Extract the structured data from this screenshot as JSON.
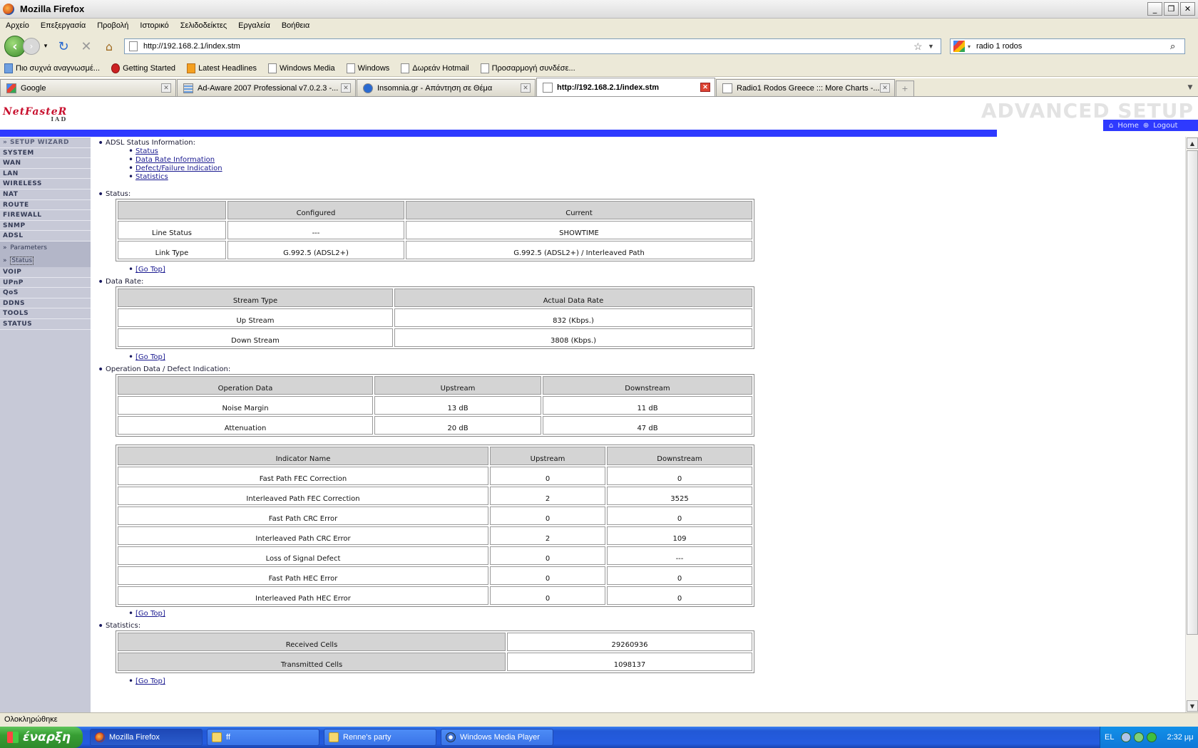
{
  "window": {
    "title": "Mozilla Firefox",
    "minimize": "_",
    "restore": "❐",
    "close": "✕"
  },
  "menu": [
    "Αρχείο",
    "Επεξεργασία",
    "Προβολή",
    "Ιστορικό",
    "Σελιδοδείκτες",
    "Εργαλεία",
    "Βοήθεια"
  ],
  "nav": {
    "url": "http://192.168.2.1/index.stm",
    "search_value": "radio 1 rodos"
  },
  "bookmarks": [
    "Πιο συχνά αναγνωσμέ...",
    "Getting Started",
    "Latest Headlines",
    "Windows Media",
    "Windows",
    "Δωρεάν Hotmail",
    "Προσαρμογή συνδέσε..."
  ],
  "tabs": [
    {
      "label": "Google",
      "active": false
    },
    {
      "label": "Ad-Aware 2007 Professional v7.0.2.3 -...",
      "active": false
    },
    {
      "label": "Insomnia.gr - Απάντηση σε Θέμα",
      "active": false
    },
    {
      "label": "http://192.168.2.1/index.stm",
      "active": true
    },
    {
      "label": "Radio1 Rodos Greece ::: More Charts -...",
      "active": false
    }
  ],
  "header": {
    "brand": "NetFasteR",
    "brand_sub": "IAD",
    "advanced": "ADVANCED SETUP",
    "home": "Home",
    "logout": "Logout"
  },
  "sidebar": {
    "items": [
      "» SETUP WIZARD",
      "SYSTEM",
      "WAN",
      "LAN",
      "WIRELESS",
      "NAT",
      "ROUTE",
      "FIREWALL",
      "SNMP",
      "ADSL"
    ],
    "sub": [
      "Parameters",
      "Status"
    ],
    "items2": [
      "VOIP",
      "UPnP",
      "QoS",
      "DDNS",
      "TOOLS",
      "STATUS"
    ]
  },
  "page": {
    "info_title": "ADSL Status Information:",
    "links": [
      "Status",
      "Data Rate Information",
      "Defect/Failure Indication",
      "Statistics"
    ],
    "status_title": "Status:",
    "status_table": {
      "headers": [
        "",
        "Configured",
        "Current"
      ],
      "rows": [
        [
          "Line Status",
          "---",
          "SHOWTIME"
        ],
        [
          "Link Type",
          "G.992.5 (ADSL2+)",
          "G.992.5 (ADSL2+) / Interleaved Path"
        ]
      ]
    },
    "gotop": "[Go Top]",
    "rate_title": "Data Rate:",
    "rate_table": {
      "headers": [
        "Stream Type",
        "Actual Data Rate"
      ],
      "rows": [
        [
          "Up Stream",
          "832 (Kbps.)"
        ],
        [
          "Down Stream",
          "3808 (Kbps.)"
        ]
      ]
    },
    "op_title": "Operation Data / Defect Indication:",
    "op_table": {
      "headers": [
        "Operation Data",
        "Upstream",
        "Downstream"
      ],
      "rows": [
        [
          "Noise Margin",
          "13 dB",
          "11 dB"
        ],
        [
          "Attenuation",
          "20 dB",
          "47 dB"
        ]
      ]
    },
    "ind_table": {
      "headers": [
        "Indicator Name",
        "Upstream",
        "Downstream"
      ],
      "rows": [
        [
          "Fast Path FEC Correction",
          "0",
          "0"
        ],
        [
          "Interleaved Path FEC Correction",
          "2",
          "3525"
        ],
        [
          "Fast Path CRC Error",
          "0",
          "0"
        ],
        [
          "Interleaved Path CRC Error",
          "2",
          "109"
        ],
        [
          "Loss of Signal Defect",
          "0",
          "---"
        ],
        [
          "Fast Path HEC Error",
          "0",
          "0"
        ],
        [
          "Interleaved Path HEC Error",
          "0",
          "0"
        ]
      ]
    },
    "stats_title": "Statistics:",
    "stats_table": {
      "rows": [
        [
          "Received Cells",
          "29260936"
        ],
        [
          "Transmitted Cells",
          "1098137"
        ]
      ]
    }
  },
  "statusbar": "Ολοκληρώθηκε",
  "taskbar": {
    "start": "έναρξη",
    "tasks": [
      "Mozilla Firefox",
      "ff",
      "Renne's party",
      "Windows Media Player"
    ],
    "lang": "EL",
    "clock": "2:32 μμ"
  }
}
